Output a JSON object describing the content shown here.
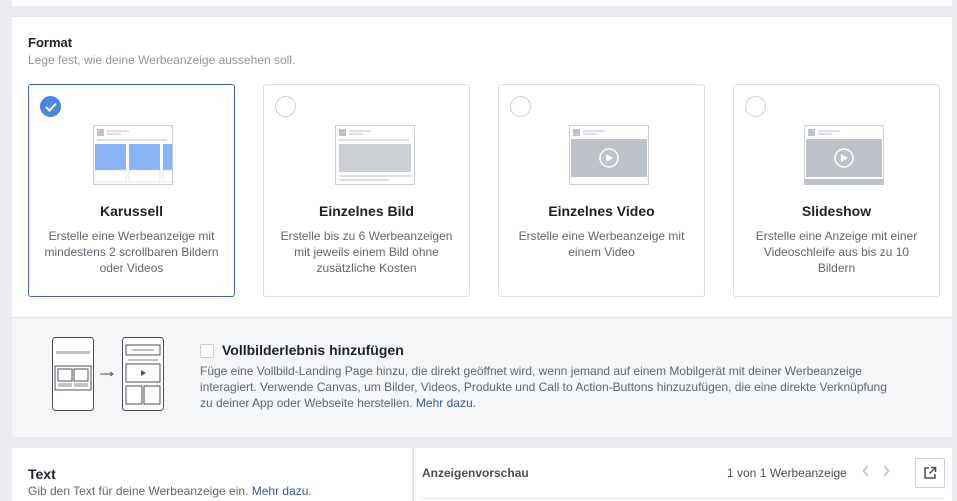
{
  "format": {
    "title": "Format",
    "subtitle": "Lege fest, wie deine Werbeanzeige aussehen soll.",
    "options": [
      {
        "title": "Karussell",
        "description": "Erstelle eine Werbeanzeige mit mindestens 2 scrollbaren Bildern oder Videos",
        "selected": true,
        "thumb_icon": "carousel-thumbnail-icon"
      },
      {
        "title": "Einzelnes Bild",
        "description": "Erstelle bis zu 6 Werbeanzeigen mit jeweils einem Bild ohne zusätzliche Kosten",
        "selected": false,
        "thumb_icon": "single-image-thumbnail-icon"
      },
      {
        "title": "Einzelnes Video",
        "description": "Erstelle eine Werbeanzeige mit einem Video",
        "selected": false,
        "thumb_icon": "single-video-thumbnail-icon"
      },
      {
        "title": "Slideshow",
        "description": "Erstelle eine Anzeige mit einer Videoschleife aus bis zu 10 Bildern",
        "selected": false,
        "thumb_icon": "slideshow-thumbnail-icon"
      }
    ]
  },
  "fullscreen": {
    "label": "Vollbilderlebnis hinzufügen",
    "checked": false,
    "description": "Füge eine Vollbild-Landing Page hinzu, die direkt geöffnet wird, wenn jemand auf einem Mobilgerät mit deiner Werbeanzeige interagiert. Verwende Canvas, um Bilder, Videos, Produkte und Call to Action-Buttons hinzuzufügen, die eine direkte Verknüpfung zu deiner App oder Webseite herstellen.",
    "link": "Mehr dazu."
  },
  "text_section": {
    "title": "Text",
    "subtitle": "Gib den Text für deine Werbeanzeige ein.",
    "link": "Mehr dazu."
  },
  "preview": {
    "title": "Anzeigenvorschau",
    "count": "1 von 1 Werbeanzeige",
    "prev_icon": "chevron-left-icon",
    "next_icon": "chevron-right-icon",
    "open_icon": "external-link-icon"
  },
  "colors": {
    "accent": "#4267b2",
    "check": "#4a85e8",
    "link": "#365899"
  }
}
